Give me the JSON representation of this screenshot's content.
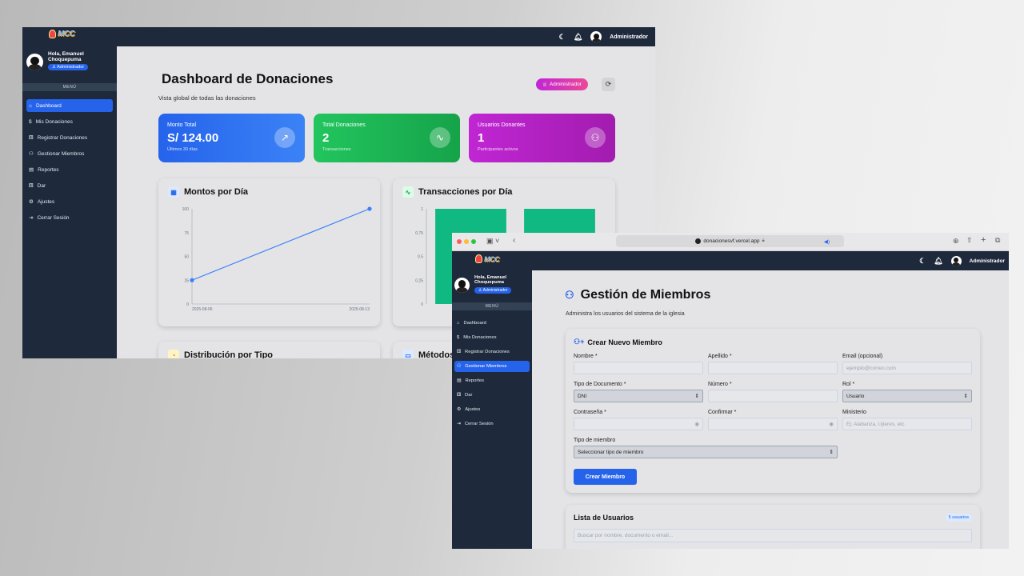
{
  "app": {
    "logo_text": "MCC",
    "admin_name": "Administrador",
    "greeting_line1": "Hola, Emanuel",
    "greeting_line2": "Choquepuma",
    "role_badge": "Administrador",
    "menu_header": "MENÚ"
  },
  "nav": [
    {
      "label": "Dashboard",
      "icon": "home-icon"
    },
    {
      "label": "Mis Donaciones",
      "icon": "dollar-icon"
    },
    {
      "label": "Registrar Donaciones",
      "icon": "gift-icon"
    },
    {
      "label": "Gestionar Miembros",
      "icon": "users-icon"
    },
    {
      "label": "Reportes",
      "icon": "file-icon"
    },
    {
      "label": "Dar",
      "icon": "gift-icon"
    },
    {
      "label": "Ajustes",
      "icon": "gear-icon"
    },
    {
      "label": "Cerrar Sesión",
      "icon": "logout-icon"
    }
  ],
  "dashboard": {
    "title": "Dashboard de Donaciones",
    "subtitle": "Vista global de todas las donaciones",
    "role_button": "Administrador",
    "cards": [
      {
        "label": "Monto Total",
        "value": "S/ 124.00",
        "sub": "Últimos 30 días",
        "color": "#2563eb"
      },
      {
        "label": "Total Donaciones",
        "value": "2",
        "sub": "Transacciones",
        "color": "#16a34a"
      },
      {
        "label": "Usuarios Donantes",
        "value": "1",
        "sub": "Participantes activos",
        "color": "#a21caf"
      }
    ],
    "panels": {
      "montos_title": "Montos por Día",
      "transacciones_title": "Transacciones por Día",
      "distribucion_title": "Distribución por Tipo",
      "metodos_title": "Métodos"
    }
  },
  "chart_data": [
    {
      "type": "line",
      "title": "Montos por Día",
      "x": [
        "2025-08-06",
        "2025-08-13"
      ],
      "values": [
        25,
        100
      ],
      "ylim": [
        0,
        100
      ],
      "yticks": [
        "100",
        "75",
        "50",
        "25",
        "0"
      ],
      "xticks": [
        "2025-08-06",
        "2025-08-13"
      ],
      "color": "#3b82f6"
    },
    {
      "type": "bar",
      "title": "Transacciones por Día",
      "values": [
        1,
        1
      ],
      "ylim": [
        0,
        1
      ],
      "yticks": [
        "1",
        "0.75",
        "0.5",
        "0.25",
        "0"
      ],
      "color": "#10b981"
    }
  ],
  "browser": {
    "url": "donacionesvf.vercel.app"
  },
  "members": {
    "title": "Gestión de Miembros",
    "subtitle": "Administra los usuarios del sistema de la iglesia",
    "create_title": "Crear Nuevo Miembro",
    "fields": {
      "nombre": "Nombre *",
      "apellido": "Apellido *",
      "email": "Email (opcional)",
      "email_ph": "ejemplo@correo.com",
      "tipo_doc": "Tipo de Documento *",
      "tipo_doc_val": "DNI",
      "numero": "Número *",
      "rol": "Rol *",
      "rol_val": "Usuario",
      "contrasena": "Contraseña *",
      "confirmar": "Confirmar *",
      "ministerio": "Ministerio",
      "ministerio_ph": "Ej: Alabanza, Ujieres, etc.",
      "tipo_miembro": "Tipo de miembro",
      "tipo_miembro_val": "Seleccionar tipo de miembro"
    },
    "submit": "Crear Miembro",
    "list_title": "Lista de Usuarios",
    "count_badge": "5 usuarios",
    "search_ph": "Buscar por nombre, documento o email..."
  }
}
